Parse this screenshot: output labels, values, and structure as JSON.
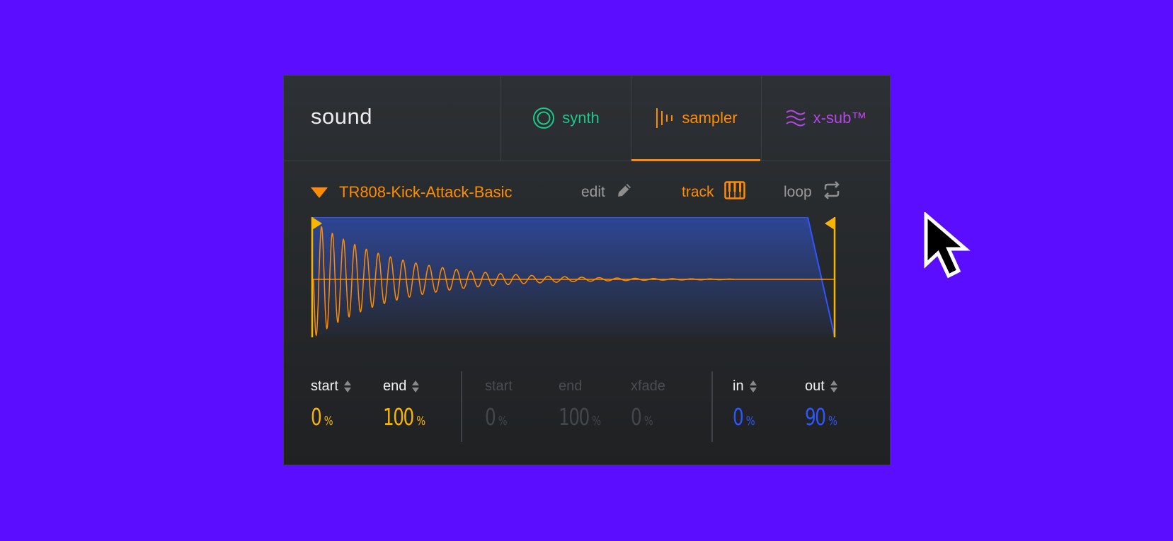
{
  "panel": {
    "title": "sound",
    "tabs": [
      {
        "label": "synth",
        "icon": "ring-icon",
        "color": "#1ec78a"
      },
      {
        "label": "sampler",
        "icon": "sampler-bars-icon",
        "color": "#ff8c00",
        "active": true
      },
      {
        "label": "x-sub™",
        "icon": "waves-icon",
        "color": "#b447e8"
      }
    ]
  },
  "sample": {
    "name": "TR808-Kick-Attack-Basic",
    "edit_label": "edit",
    "track_label": "track",
    "loop_label": "loop"
  },
  "sample_region": {
    "start_label": "start",
    "start_value": "0",
    "end_label": "end",
    "end_value": "100",
    "unit": "%"
  },
  "loop_region": {
    "start_label": "start",
    "start_value": "0",
    "end_label": "end",
    "end_value": "100",
    "xfade_label": "xfade",
    "xfade_value": "0",
    "unit": "%"
  },
  "fade": {
    "in_label": "in",
    "in_value": "0",
    "out_label": "out",
    "out_value": "90",
    "unit": "%"
  },
  "colors": {
    "background": "#5b0dff",
    "accent_orange": "#ff8c00",
    "marker_yellow": "#f7b500",
    "envelope_blue": "#2f55ff",
    "synth_green": "#1ec78a",
    "xsub_purple": "#b447e8"
  }
}
